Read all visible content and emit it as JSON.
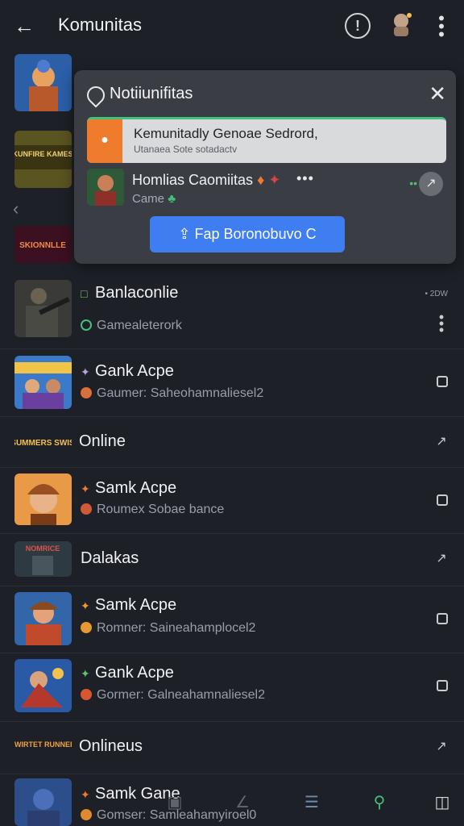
{
  "header": {
    "title": "Komunitas",
    "back_icon": "arrow-left-icon",
    "info_icon": "info-icon",
    "menu_icon": "more-vertical-icon"
  },
  "notification": {
    "title": "Notiiunifitas",
    "banner": {
      "main": "Kemunitadly Genoae Sedrord,",
      "sub": "Utanaea Sote sotadactv"
    },
    "item": {
      "name": "Homlias Caomiitas",
      "game": "Came",
      "more": "•••",
      "dots": "••"
    },
    "button_label": "Fap Boronobuvo C"
  },
  "rows": [
    {
      "title": "Banlaconlie",
      "subtitle": "Gamealeterork",
      "tag": "• 2DW"
    },
    {
      "title": "Gank Acpe",
      "subtitle": "Gaumer: Saheohamnaliesel2"
    },
    {
      "title": "Online"
    },
    {
      "title": "Samk Acpe",
      "subtitle": "Roumex Sobae bance"
    },
    {
      "title": "Dalakas"
    },
    {
      "title": "Samk Acpe",
      "subtitle": "Romner: Saineahamplocel2"
    },
    {
      "title": "Gank Acpe",
      "subtitle": "Gormer: Galneahamnaliesel2"
    },
    {
      "title": "Onlineus"
    },
    {
      "title": "Samk Gane",
      "subtitle": "Gomser: Samleahamyiroel0"
    }
  ],
  "thumb_labels": [
    "KUNFIRE KAMES",
    "SKIONNLLE",
    "SUMMERS SWIS",
    "NOMRICE",
    "TWIRTET RUNNER"
  ],
  "colors": {
    "background": "#1d2027",
    "accent_blue": "#3f7ef0",
    "accent_orange": "#ef7b2c",
    "accent_green": "#44c07a"
  }
}
